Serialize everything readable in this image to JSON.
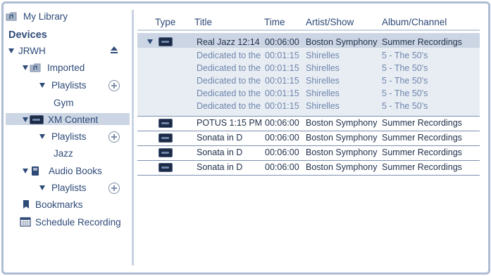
{
  "sidebar": {
    "my_library": "My Library",
    "devices_heading": "Devices",
    "device_name": "JRWH",
    "imported": "Imported",
    "playlists_1": "Playlists",
    "gym": "Gym",
    "xm_content": "XM Content",
    "playlists_2": "Playlists",
    "jazz": "Jazz",
    "audio_books": "Audio Books",
    "playlists_3": "Playlists",
    "bookmarks": "Bookmarks",
    "schedule_recording": "Schedule Recording"
  },
  "table": {
    "headers": {
      "type": "Type",
      "title": "Title",
      "time": "Time",
      "artist": "Artist/Show",
      "album": "Album/Channel"
    },
    "group": {
      "title": "Real Jazz 12:14",
      "time": "00:06:00",
      "artist": "Boston Symphony",
      "album": "Summer Recordings",
      "children": [
        {
          "title": "Dedicated to the",
          "time": "00:01:15",
          "artist": "Shirelles",
          "album": "5 - The 50's"
        },
        {
          "title": "Dedicated to the",
          "time": "00:01:15",
          "artist": "Shirelles",
          "album": "5 - The 50's"
        },
        {
          "title": "Dedicated to the",
          "time": "00:01:15",
          "artist": "Shirelles",
          "album": "5 - The 50's"
        },
        {
          "title": "Dedicated to the",
          "time": "00:01:15",
          "artist": "Shirelles",
          "album": "5 - The 50's"
        },
        {
          "title": "Dedicated to the",
          "time": "00:01:15",
          "artist": "Shirelles",
          "album": "5 - The 50's"
        }
      ]
    },
    "rows": [
      {
        "title": "POTUS 1:15 PM",
        "time": "00:06:00",
        "artist": "Boston Symphony",
        "album": "Summer Recordings"
      },
      {
        "title": "Sonata in D",
        "time": "00:06:00",
        "artist": "Boston Symphony",
        "album": "Summer Recordings"
      },
      {
        "title": "Sonata in D",
        "time": "00:06:00",
        "artist": "Boston Symphony",
        "album": "Summer Recordings"
      },
      {
        "title": "Sonata in D",
        "time": "00:06:00",
        "artist": "Boston Symphony",
        "album": "Summer Recordings"
      }
    ]
  }
}
